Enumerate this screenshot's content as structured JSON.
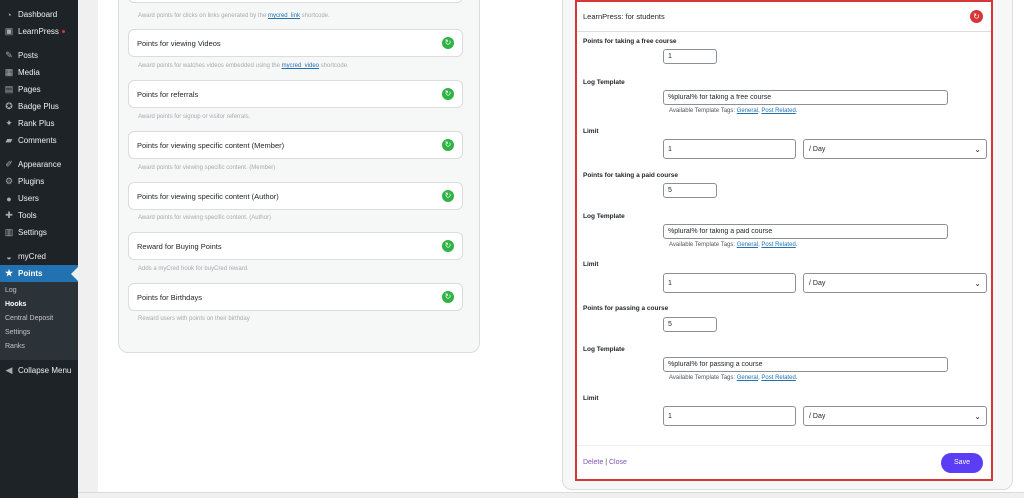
{
  "sidebar": {
    "menu": [
      {
        "label": "Dashboard",
        "icon": "dashboard-icon"
      },
      {
        "label": "LearnPress",
        "icon": "learnpress-icon",
        "badge": true
      },
      {
        "label": "Posts",
        "icon": "pin-icon"
      },
      {
        "label": "Media",
        "icon": "media-icon"
      },
      {
        "label": "Pages",
        "icon": "pages-icon"
      },
      {
        "label": "Badge Plus",
        "icon": "badge-icon"
      },
      {
        "label": "Rank Plus",
        "icon": "rank-icon"
      },
      {
        "label": "Comments",
        "icon": "comment-icon"
      },
      {
        "label": "Appearance",
        "icon": "brush-icon"
      },
      {
        "label": "Plugins",
        "icon": "plugin-icon"
      },
      {
        "label": "Users",
        "icon": "users-icon"
      },
      {
        "label": "Tools",
        "icon": "wrench-icon"
      },
      {
        "label": "Settings",
        "icon": "settings-icon"
      },
      {
        "label": "myCred",
        "icon": "mycred-icon"
      },
      {
        "label": "Points",
        "icon": "star-icon"
      }
    ],
    "submenu": [
      "Log",
      "Hooks",
      "Central Deposit",
      "Settings",
      "Ranks"
    ],
    "current_submenu": "Hooks",
    "collapse_label": "Collapse Menu"
  },
  "hooks": [
    {
      "title": "",
      "desc_before": "Award points for clicks on links generated by the ",
      "link": "mycred_link",
      "desc_after": " shortcode."
    },
    {
      "title": "Points for viewing Videos",
      "desc_before": "Award points for watches videos embedded using the ",
      "link": "mycred_video",
      "desc_after": " shortcode."
    },
    {
      "title": "Points for referrals",
      "desc_before": "Award points for signup or visitor referrals.",
      "link": "",
      "desc_after": ""
    },
    {
      "title": "Points for viewing specific content (Member)",
      "desc_before": "Award points for viewing specific content. (Member)",
      "link": "",
      "desc_after": ""
    },
    {
      "title": "Points for viewing specific content (Author)",
      "desc_before": "Award points for viewing specific content. (Author)",
      "link": "",
      "desc_after": ""
    },
    {
      "title": "Reward for Buying Points",
      "desc_before": "Adds a myCred hook for buyCred reward.",
      "link": "",
      "desc_after": ""
    },
    {
      "title": "Points for Birthdays",
      "desc_before": "Reward users with points on their birthday",
      "link": "",
      "desc_after": ""
    }
  ],
  "settings": {
    "title": "LearnPress: for students",
    "sections": [
      {
        "points_label": "Points for taking a free course",
        "points_value": "1",
        "log_label": "Log Template",
        "log_value": "%plural% for taking a free course",
        "limit_label": "Limit",
        "limit_value": "1",
        "limit_period": "/ Day"
      },
      {
        "points_label": "Points for taking a paid course",
        "points_value": "5",
        "log_label": "Log Template",
        "log_value": "%plural% for taking a paid course",
        "limit_label": "Limit",
        "limit_value": "1",
        "limit_period": "/ Day"
      },
      {
        "points_label": "Points for passing a course",
        "points_value": "5",
        "log_label": "Log Template",
        "log_value": "%plural% for passing a course",
        "limit_label": "Limit",
        "limit_value": "1",
        "limit_period": "/ Day"
      }
    ],
    "tags_prefix": "Available Template Tags: ",
    "tag_general": "General",
    "tag_separator": ", ",
    "tag_post": "Post Related",
    "tags_suffix": ".",
    "delete_label": "Delete",
    "pipe": "|",
    "close_label": "Close",
    "save_label": "Save"
  },
  "colors": {
    "admin_bar": "#1d2327",
    "active_menu": "#2271b1",
    "toggle_on": "#2fb344",
    "highlight_border": "#d63638",
    "save_button": "#5b3df5"
  }
}
